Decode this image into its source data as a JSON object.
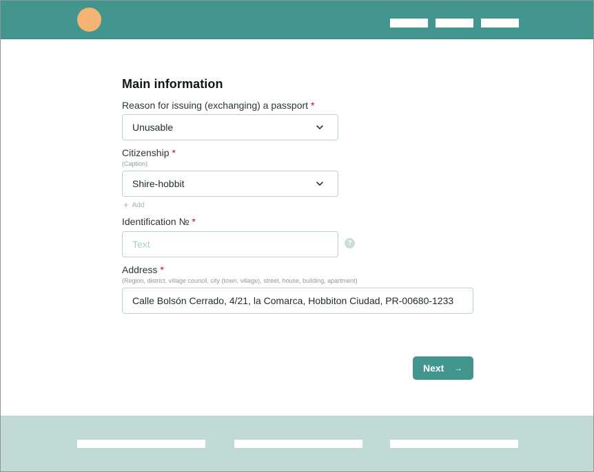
{
  "header": {
    "nav": [
      "",
      "",
      ""
    ]
  },
  "form": {
    "title": "Main information",
    "required_mark": "*",
    "reason": {
      "label": "Reason for issuing (exchanging) a passport",
      "value": "Unusable"
    },
    "citizenship": {
      "label": "Citizenship",
      "caption": "(Caption)",
      "value": "Shire-hobbit",
      "add_label": "Add"
    },
    "identification": {
      "label": "Identification №",
      "placeholder": "Text",
      "help": "?"
    },
    "address": {
      "label": "Address",
      "caption": "(Region, district, village council, city (town, village), street, house, building, apartment)",
      "value": "Calle Bolsón Cerrado, 4/21, la Comarca, Hobbiton Ciudad, PR-00680-1233"
    },
    "next_label": "Next",
    "next_arrow": "→"
  },
  "colors": {
    "brand": "#43968e",
    "logo": "#f5b374",
    "footer": "#c2dad6",
    "required": "#d0021b"
  }
}
